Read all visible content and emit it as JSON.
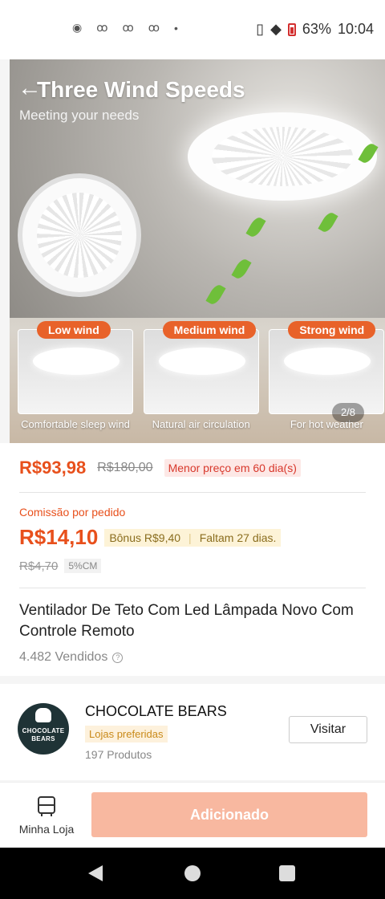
{
  "status_bar": {
    "battery": "63%",
    "time": "10:04"
  },
  "hero": {
    "title": "Three Wind Speeds",
    "subtitle": "Meeting your needs",
    "counter": "2/8",
    "modes": [
      {
        "label": "Low wind",
        "caption": "Comfortable sleep wind"
      },
      {
        "label": "Medium wind",
        "caption": "Natural air circulation"
      },
      {
        "label": "Strong wind",
        "caption": "For hot weather"
      }
    ]
  },
  "price": {
    "current": "R$93,98",
    "original": "R$180,00",
    "tag": "Menor preço em 60 dia(s)"
  },
  "commission": {
    "label": "Comissão por pedido",
    "value": "R$14,10",
    "bonus": "Bônus R$9,40",
    "remaining": "Faltam 27 dias.",
    "old_value": "R$4,70",
    "rate": "5%CM"
  },
  "product": {
    "title": "Ventilador De Teto Com Led Lâmpada Novo Com Controle Remoto",
    "sold": "4.482 Vendidos"
  },
  "shop": {
    "logo_text": "CHOCOLATE BEARS",
    "name": "CHOCOLATE BEARS",
    "badge": "Lojas preferidas",
    "products": "197 Produtos",
    "visit_label": "Visitar"
  },
  "action_bar": {
    "my_store_label": "Minha Loja",
    "add_label": "Adicionado"
  },
  "colors": {
    "accent": "#e8501c",
    "added_button": "#f8b8a0"
  }
}
